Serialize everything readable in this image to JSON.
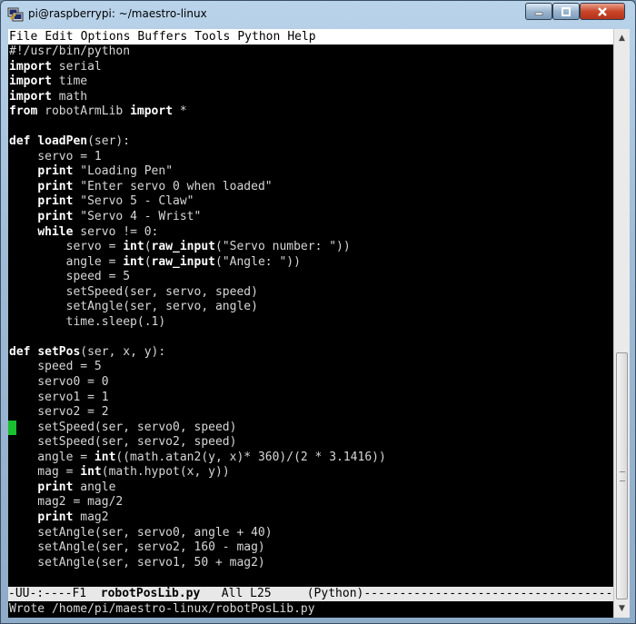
{
  "window": {
    "title": "pi@raspberrypi: ~/maestro-linux",
    "icon": "putty-icon",
    "buttons": {
      "minimize": "minimize-icon",
      "maximize": "maximize-icon",
      "close": "close-icon"
    }
  },
  "menubar": {
    "items": [
      "File",
      "Edit",
      "Options",
      "Buffers",
      "Tools",
      "Python",
      "Help"
    ]
  },
  "editor": {
    "lines": [
      [
        {
          "t": "#!/usr/bin/python"
        }
      ],
      [
        {
          "t": "import",
          "k": true
        },
        {
          "t": " serial"
        }
      ],
      [
        {
          "t": "import",
          "k": true
        },
        {
          "t": " time"
        }
      ],
      [
        {
          "t": "import",
          "k": true
        },
        {
          "t": " math"
        }
      ],
      [
        {
          "t": "from",
          "k": true
        },
        {
          "t": " robotArmLib "
        },
        {
          "t": "import",
          "k": true
        },
        {
          "t": " *"
        }
      ],
      [
        {
          "t": ""
        }
      ],
      [
        {
          "t": "def",
          "k": true
        },
        {
          "t": " "
        },
        {
          "t": "loadPen",
          "k": true
        },
        {
          "t": "(ser):"
        }
      ],
      [
        {
          "t": "    servo = 1"
        }
      ],
      [
        {
          "t": "    "
        },
        {
          "t": "print",
          "k": true
        },
        {
          "t": " \"Loading Pen\""
        }
      ],
      [
        {
          "t": "    "
        },
        {
          "t": "print",
          "k": true
        },
        {
          "t": " \"Enter servo 0 when loaded\""
        }
      ],
      [
        {
          "t": "    "
        },
        {
          "t": "print",
          "k": true
        },
        {
          "t": " \"Servo 5 - Claw\""
        }
      ],
      [
        {
          "t": "    "
        },
        {
          "t": "print",
          "k": true
        },
        {
          "t": " \"Servo 4 - Wrist\""
        }
      ],
      [
        {
          "t": "    "
        },
        {
          "t": "while",
          "k": true
        },
        {
          "t": " servo != 0:"
        }
      ],
      [
        {
          "t": "        servo = "
        },
        {
          "t": "int",
          "k": true
        },
        {
          "t": "("
        },
        {
          "t": "raw_input",
          "k": true
        },
        {
          "t": "(\"Servo number: \"))"
        }
      ],
      [
        {
          "t": "        angle = "
        },
        {
          "t": "int",
          "k": true
        },
        {
          "t": "("
        },
        {
          "t": "raw_input",
          "k": true
        },
        {
          "t": "(\"Angle: \"))"
        }
      ],
      [
        {
          "t": "        speed = 5"
        }
      ],
      [
        {
          "t": "        setSpeed(ser, servo, speed)"
        }
      ],
      [
        {
          "t": "        setAngle(ser, servo, angle)"
        }
      ],
      [
        {
          "t": "        time.sleep(.1)"
        }
      ],
      [
        {
          "t": ""
        }
      ],
      [
        {
          "t": "def",
          "k": true
        },
        {
          "t": " "
        },
        {
          "t": "setPos",
          "k": true
        },
        {
          "t": "(ser, x, y):"
        }
      ],
      [
        {
          "t": "    speed = 5"
        }
      ],
      [
        {
          "t": "    servo0 = 0"
        }
      ],
      [
        {
          "t": "    servo1 = 1"
        }
      ],
      [
        {
          "t": "    servo2 = 2"
        }
      ],
      [
        {
          "t": "    setSpeed(ser, servo0, speed)"
        }
      ],
      [
        {
          "t": "    setSpeed(ser, servo2, speed)"
        }
      ],
      [
        {
          "t": "    angle = "
        },
        {
          "t": "int",
          "k": true
        },
        {
          "t": "((math.atan2(y, x)* 360)/(2 * 3.1416))"
        }
      ],
      [
        {
          "t": "    mag = "
        },
        {
          "t": "int",
          "k": true
        },
        {
          "t": "(math.hypot(x, y))"
        }
      ],
      [
        {
          "t": "    "
        },
        {
          "t": "print",
          "k": true
        },
        {
          "t": " angle"
        }
      ],
      [
        {
          "t": "    mag2 = mag/2"
        }
      ],
      [
        {
          "t": "    "
        },
        {
          "t": "print",
          "k": true
        },
        {
          "t": " mag2"
        }
      ],
      [
        {
          "t": "    setAngle(ser, servo0, angle + 40)"
        }
      ],
      [
        {
          "t": "    setAngle(ser, servo2, 160 - mag)"
        }
      ],
      [
        {
          "t": "    setAngle(ser, servo1, 50 + mag2)"
        }
      ]
    ],
    "cursor_color": "#19c030"
  },
  "modeline": {
    "status": "-UU-:----F1  ",
    "filename": "robotPosLib.py",
    "position": "   All L25     ",
    "mode": "(Python)",
    "fill": "--------------------------------------------"
  },
  "minibuffer": {
    "message": "Wrote /home/pi/maestro-linux/robotPosLib.py"
  },
  "colors": {
    "background": "#000000",
    "text": "#d7d7d7",
    "keyword": "#ffffff",
    "modeline_bg": "#e8e8e8"
  }
}
